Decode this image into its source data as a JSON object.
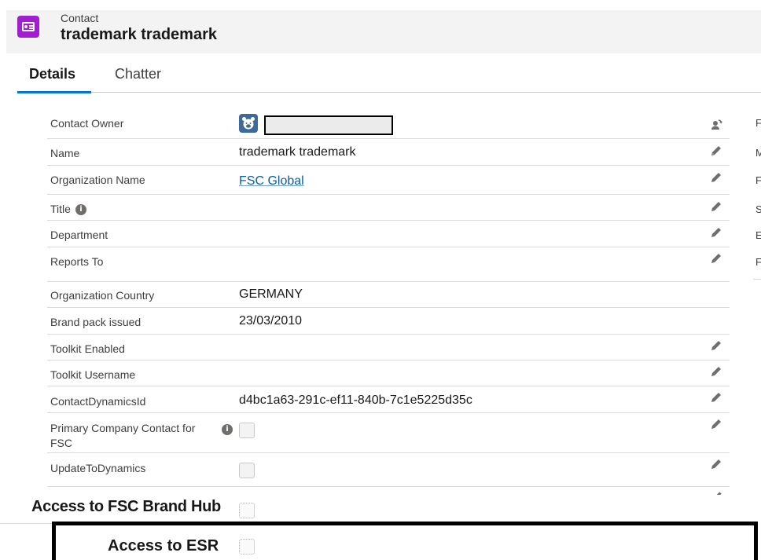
{
  "header": {
    "object_type": "Contact",
    "record_title": "trademark trademark",
    "icon": "contact-card-icon",
    "icon_color": "#a020d0"
  },
  "tabs": [
    {
      "label": "Details",
      "active": true
    },
    {
      "label": "Chatter",
      "active": false
    }
  ],
  "fields": {
    "contact_owner": {
      "label": "Contact Owner",
      "value": "",
      "action_icon": "change-owner-icon"
    },
    "name": {
      "label": "Name",
      "value": "trademark trademark"
    },
    "organization_name": {
      "label": "Organization Name",
      "value": "FSC Global"
    },
    "title": {
      "label": "Title",
      "value": ""
    },
    "department": {
      "label": "Department",
      "value": ""
    },
    "reports_to": {
      "label": "Reports To",
      "value": ""
    },
    "organization_country": {
      "label": "Organization Country",
      "value": "GERMANY"
    },
    "brand_pack_issued": {
      "label": "Brand pack issued",
      "value": "23/03/2010"
    },
    "toolkit_enabled": {
      "label": "Toolkit Enabled",
      "value": ""
    },
    "toolkit_username": {
      "label": "Toolkit Username",
      "value": ""
    },
    "contact_dynamics_id": {
      "label": "ContactDynamicsId",
      "value": "d4bc1a63-291c-ef11-840b-7c1e5225d35c"
    },
    "primary_company_contact": {
      "label": "Primary Company Contact for FSC",
      "checked": false
    },
    "update_to_dynamics": {
      "label": "UpdateToDynamics",
      "checked": false
    },
    "access_brand_hub": {
      "label": "Access to FSC Brand Hub",
      "checked": false
    },
    "access_esr": {
      "label": "Access to ESR",
      "checked": false
    }
  },
  "right_column_initials": [
    "F",
    "M",
    "F",
    "S",
    "E",
    "F"
  ],
  "colors": {
    "accent": "#0176d3",
    "link": "#0b5cab"
  }
}
